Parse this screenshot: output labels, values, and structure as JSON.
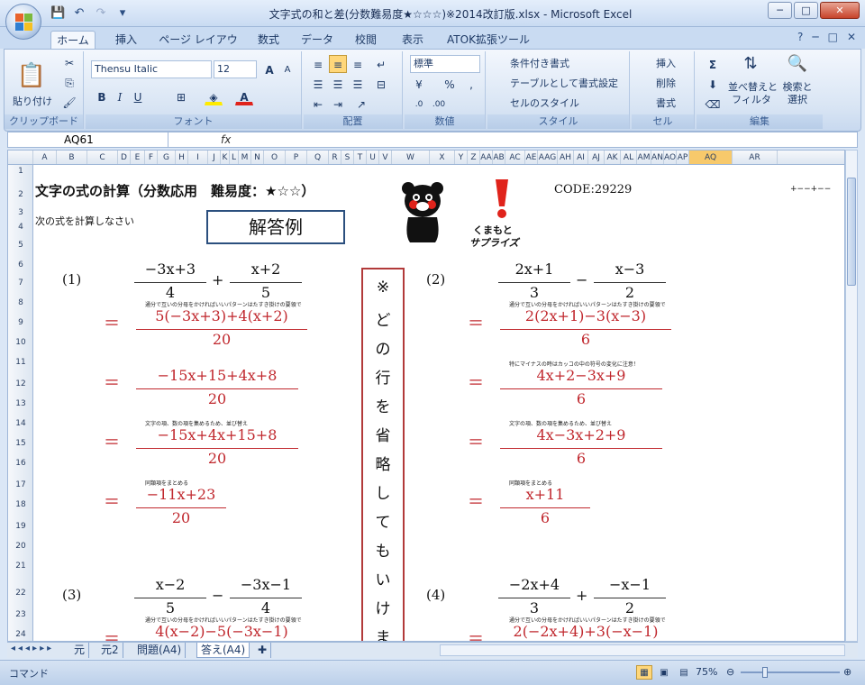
{
  "window": {
    "title": "文字式の和と差(分数難易度★☆☆☆)※2014改訂版.xlsx - Microsoft Excel",
    "min": "─",
    "max": "□",
    "close": "✕"
  },
  "tabs": [
    "ホーム",
    "挿入",
    "ページ レイアウト",
    "数式",
    "データ",
    "校閲",
    "表示",
    "ATOK拡張ツール"
  ],
  "ribbon": {
    "clipboard": {
      "paste": "貼り付け",
      "label": "クリップボード"
    },
    "font": {
      "name": "Thensu Italic",
      "size": "12",
      "label": "フォント"
    },
    "alignment": {
      "label": "配置"
    },
    "number": {
      "format": "標準",
      "label": "数値"
    },
    "styles": {
      "conditional": "条件付き書式",
      "table": "テーブルとして書式設定",
      "cell": "セルのスタイル",
      "label": "スタイル"
    },
    "cells": {
      "insert": "挿入",
      "delete": "削除",
      "format": "書式",
      "label": "セル"
    },
    "editing": {
      "sort": "並べ替えと",
      "filter": "フィルタ",
      "find": "検索と",
      "select": "選択",
      "label": "編集"
    }
  },
  "formula": {
    "cell": "AQ61",
    "fx": "fx",
    "value": ""
  },
  "columns": [
    "A",
    "B",
    "C",
    "D",
    "E",
    "F",
    "G",
    "H",
    "I",
    "J",
    "K",
    "L",
    "M",
    "N",
    "O",
    "P",
    "Q",
    "R",
    "S",
    "T",
    "U",
    "V",
    "W",
    "X",
    "Y",
    "Z",
    "AA",
    "AB",
    "AC",
    "AE",
    "AAG",
    "AH",
    "AI",
    "AJ",
    "AK",
    "AL",
    "AM",
    "AN",
    "AO",
    "AP",
    "AQ",
    "AR"
  ],
  "rows": [
    "1",
    "2",
    "3",
    "4",
    "5",
    "6",
    "7",
    "8",
    "9",
    "10",
    "11",
    "12",
    "13",
    "14",
    "15",
    "16",
    "17",
    "18",
    "19",
    "20",
    "21",
    "22",
    "23",
    "24"
  ],
  "sheet": {
    "title": "文字の式の計算（分数応用　難易度：★☆☆）",
    "instruction": "次の式を計算しなさい",
    "answer_badge": "解答例",
    "code": "CODE:29229",
    "mark": "+−−+−−",
    "logo_text1": "くまもと",
    "logo_text2": "サプライズ",
    "vertical_note": [
      "※",
      "ど",
      "の",
      "行",
      "を",
      "省",
      "略",
      "し",
      "て",
      "も",
      "い",
      "け",
      "ま"
    ],
    "problems": [
      {
        "label": "(1)",
        "t1_num": "−3x+3",
        "t1_den": "4",
        "op": "+",
        "t2_num": "x+2",
        "t2_den": "5",
        "note1": "通分で互いの分母をかければいいパターンはたすき掛けの要領で",
        "s1_num": "5(−3x+3)+4(x+2)",
        "s1_den": "20",
        "note2": "",
        "s2_num": "−15x+15+4x+8",
        "s2_den": "20",
        "note3": "文字の項、数の項を集めるため、並び替え",
        "s3_num": "−15x+4x+15+8",
        "s3_den": "20",
        "note4": "同類項をまとめる",
        "s4_num": "−11x+23",
        "s4_den": "20"
      },
      {
        "label": "(2)",
        "t1_num": "2x+1",
        "t1_den": "3",
        "op": "−",
        "t2_num": "x−3",
        "t2_den": "2",
        "note1": "通分で互いの分母をかければいいパターンはたすき掛けの要領で",
        "s1_num": "2(2x+1)−3(x−3)",
        "s1_den": "6",
        "note2": "特にマイナスの時はカッコの中の符号の変化に注意！",
        "s2_num": "4x+2−3x+9",
        "s2_den": "6",
        "note3": "文字の項、数の項を集めるため、並び替え",
        "s3_num": "4x−3x+2+9",
        "s3_den": "6",
        "note4": "同類項をまとめる",
        "s4_num": "x+11",
        "s4_den": "6"
      },
      {
        "label": "(3)",
        "t1_num": "x−2",
        "t1_den": "5",
        "op": "−",
        "t2_num": "−3x−1",
        "t2_den": "4",
        "note1": "通分で互いの分母をかければいいパターンはたすき掛けの要領で",
        "s1_num": "4(x−2)−5(−3x−1)"
      },
      {
        "label": "(4)",
        "t1_num": "−2x+4",
        "t1_den": "3",
        "op": "+",
        "t2_num": "−x−1",
        "t2_den": "2",
        "note1": "通分で互いの分母をかければいいパターンはたすき掛けの要領で",
        "s1_num": "2(−2x+4)+3(−x−1)"
      }
    ],
    "equals": "＝"
  },
  "sheet_tabs": [
    "元",
    "元2",
    "問題(A4)",
    "答え(A4)"
  ],
  "status": {
    "mode": "コマンド",
    "zoom": "75%"
  }
}
